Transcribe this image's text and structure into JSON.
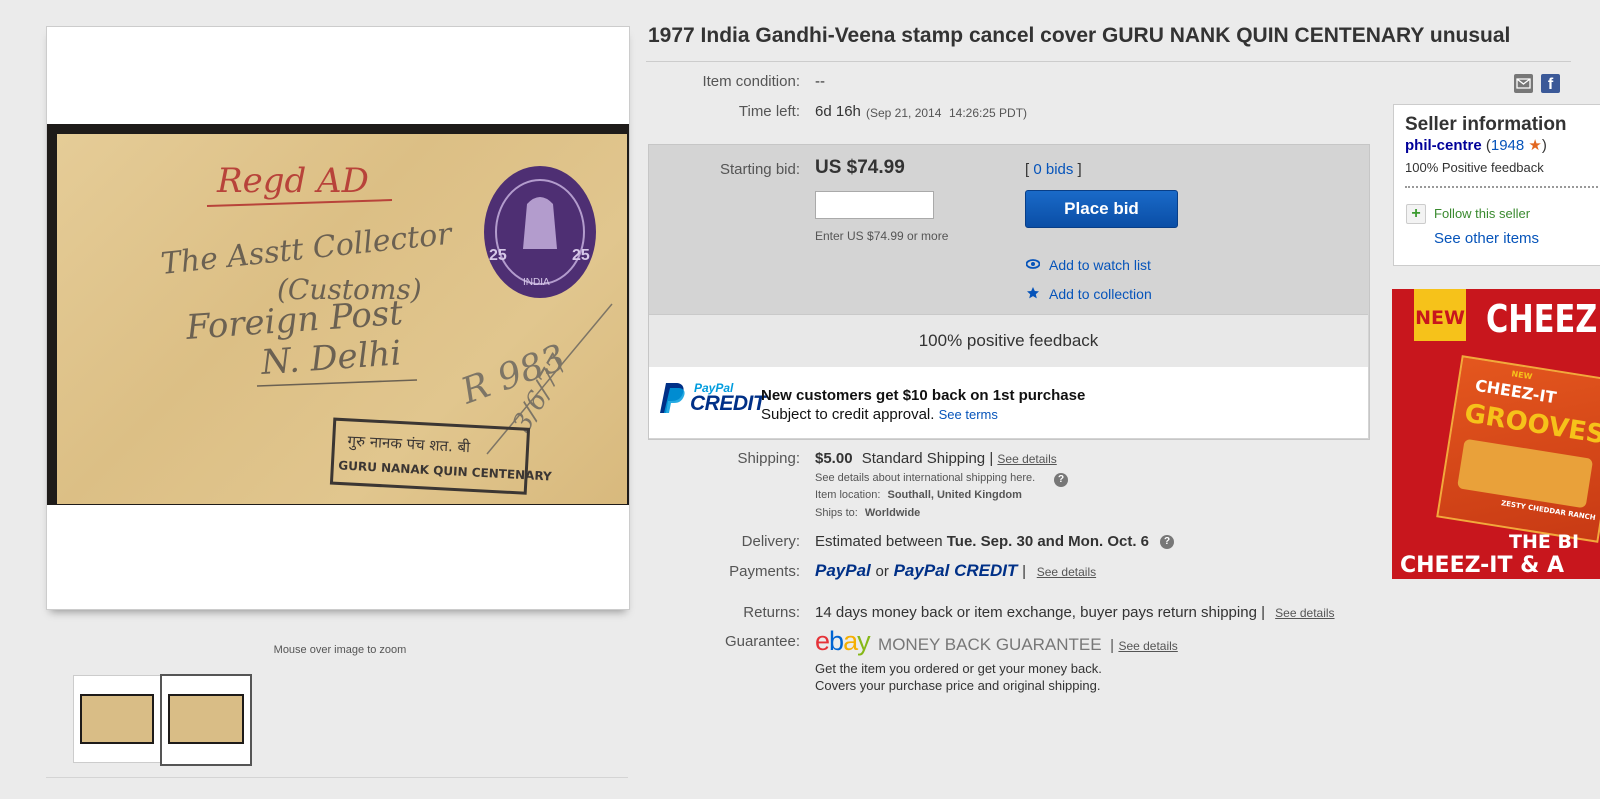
{
  "listing": {
    "title": "1977 India Gandhi-Veena stamp cancel cover GURU NANK QUIN CENTENARY unusual",
    "zoom_hint": "Mouse over image to zoom"
  },
  "details": {
    "condition_label": "Item condition:",
    "condition_value": "--",
    "time_left_label": "Time left:",
    "time_left_value": "6d 16h",
    "end_date": "(Sep 21, 2014",
    "end_time": "14:26:25 PDT)"
  },
  "bid": {
    "label": "Starting bid:",
    "price": "US $74.99",
    "bids_open": "[",
    "bids_count": "0 bids",
    "bids_close": "]",
    "input_hint": "Enter US $74.99 or more",
    "place_bid": "Place bid",
    "watch": "Add to watch list",
    "collection": "Add to collection",
    "feedback_strip": "100% positive feedback"
  },
  "paypal_promo": {
    "logo_top": "PayPal",
    "logo_bottom": "CREDIT",
    "headline": "New customers get $10 back on 1st purchase",
    "sub": "Subject to credit approval.",
    "terms": "See terms"
  },
  "shipping": {
    "label": "Shipping:",
    "cost": "$5.00",
    "method": "Standard Shipping |",
    "see_details": "See details",
    "intl_note": "See details about international shipping here.",
    "location_label": "Item location:",
    "location": "Southall, United Kingdom",
    "ships_to_label": "Ships to:",
    "ships_to": "Worldwide"
  },
  "delivery": {
    "label": "Delivery:",
    "prefix": "Estimated between",
    "dates": "Tue. Sep. 30 and Mon. Oct. 6"
  },
  "payments": {
    "label": "Payments:",
    "paypal": "PayPal",
    "or": "or",
    "paypal_credit_a": "PayPal",
    "paypal_credit_b": "CREDIT",
    "sep": "|",
    "see_details": "See details"
  },
  "returns": {
    "label": "Returns:",
    "text": "14 days money back or item exchange, buyer pays return shipping |",
    "see_details": "See details"
  },
  "guarantee": {
    "label": "Guarantee:",
    "brand_e": "e",
    "brand_b": "b",
    "brand_a": "a",
    "brand_y": "y",
    "mbg": "MONEY BACK GUARANTEE",
    "sep": "|",
    "see_details": "See details",
    "line1": "Get the item you ordered or get your money back.",
    "line2": "Covers your purchase price and original shipping."
  },
  "seller": {
    "heading": "Seller information",
    "name": "phil-centre",
    "score_open": "(",
    "score": "1948",
    "score_close": ")",
    "feedback": "100% Positive feedback",
    "follow": "Follow this seller",
    "see_other": "See other items"
  },
  "ad": {
    "new": "NEW",
    "brand": "CHEEZ",
    "pack_new": "NEW",
    "pack_brand": "CHEEZ-IT",
    "pack_name": "GROOVES",
    "pack_flavor": "ZESTY CHEDDAR RANCH",
    "line1": "THE BI",
    "line2": "CHEEZ-IT & A"
  },
  "envelope": {
    "reg": "Regd AD",
    "addr1": "The Asstt Collector",
    "addr2": "(Customs)",
    "addr3": "Foreign Post",
    "addr4": "N. Delhi",
    "stamp_value_left": "25",
    "stamp_value_right": "25",
    "stamp_country": "INDIA",
    "cancel_hindi": "गुरु नानक पंच शत. बी",
    "cancel_text": "GURU NANAK QUIN CENTENARY",
    "note": "R 983",
    "note_date": "3/6/77"
  },
  "colors": {
    "link": "#0654ba",
    "button": "#0654ba",
    "ebay_e": "#e53238",
    "ebay_b": "#0064d2",
    "ebay_a": "#f5af02",
    "ebay_y": "#86b817",
    "paypal_dark": "#003087",
    "paypal_light": "#009cde"
  }
}
